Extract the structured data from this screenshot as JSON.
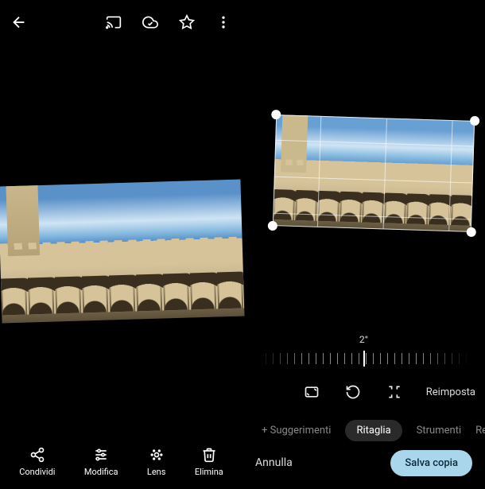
{
  "left": {
    "bottombar": [
      {
        "name": "share",
        "label": "Condividi"
      },
      {
        "name": "edit",
        "label": "Modifica"
      },
      {
        "name": "lens",
        "label": "Lens"
      },
      {
        "name": "delete",
        "label": "Elimina"
      }
    ]
  },
  "right": {
    "angle_label": "2°",
    "tool_reset": "Reimposta",
    "tabs": [
      {
        "name": "suggestions",
        "label": "Suggerimenti",
        "prefix": "+",
        "active": false
      },
      {
        "name": "crop",
        "label": "Ritaglia",
        "active": true
      },
      {
        "name": "tools",
        "label": "Strumenti",
        "active": false
      },
      {
        "name": "adjust",
        "label": "Rego",
        "active": false
      }
    ],
    "footer": {
      "cancel": "Annulla",
      "save": "Salva copia"
    }
  }
}
